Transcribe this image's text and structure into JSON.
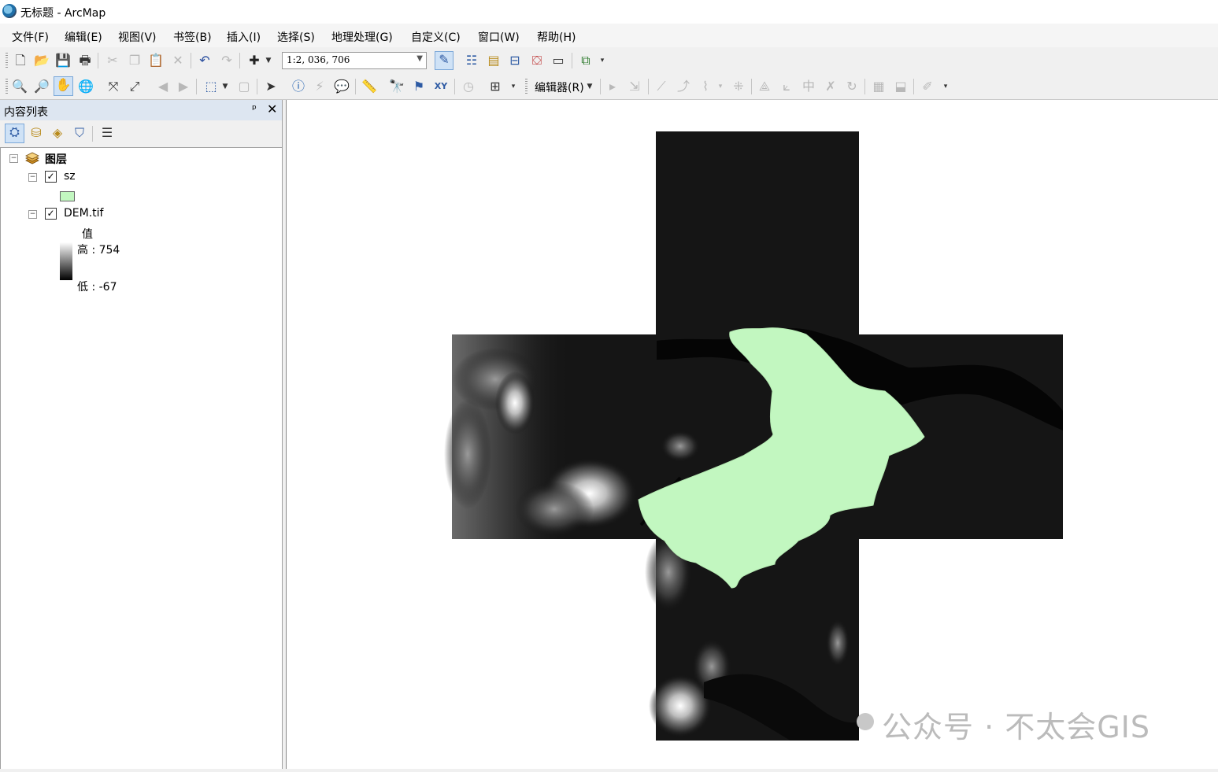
{
  "window": {
    "title": "无标题 - ArcMap"
  },
  "menubar": {
    "items": [
      "文件(F)",
      "编辑(E)",
      "视图(V)",
      "书签(B)",
      "插入(I)",
      "选择(S)",
      "地理处理(G)",
      "自定义(C)",
      "窗口(W)",
      "帮助(H)"
    ]
  },
  "toolbar": {
    "scale_value": "1:2, 036, 706",
    "editor_label": "编辑器(R)"
  },
  "toc": {
    "title": "内容列表",
    "root_label": "图层",
    "layers": [
      {
        "name": "sz",
        "checked": true,
        "symbol_color": "#c2f7c0"
      },
      {
        "name": "DEM.tif",
        "checked": true,
        "legend_field": "值",
        "high_label": "高 : 754",
        "low_label": "低 : -67"
      }
    ]
  },
  "map": {
    "raster_name": "DEM.tif",
    "polygon_layer": "sz",
    "polygon_color": "#c2f7c0",
    "background_color": "#ffffff"
  },
  "watermark": {
    "text": "公众号 · 不太会GIS"
  },
  "icons": [
    "new-document-icon",
    "open-icon",
    "save-icon",
    "print-icon",
    "cut-icon",
    "copy-icon",
    "paste-icon",
    "delete-icon",
    "undo-icon",
    "redo-icon",
    "add-data-icon",
    "editor-toolbar-icon",
    "table-of-contents-icon",
    "catalog-icon",
    "search-window-icon",
    "arctoolbox-icon",
    "python-icon",
    "model-builder-icon",
    "zoom-in-icon",
    "zoom-out-icon",
    "pan-icon",
    "full-extent-icon",
    "fixed-zoom-in-icon",
    "fixed-zoom-out-icon",
    "back-extent-icon",
    "forward-extent-icon",
    "select-features-icon",
    "clear-selection-icon",
    "select-elements-icon",
    "identify-icon",
    "hyperlink-icon",
    "html-popup-icon",
    "measure-icon",
    "find-icon",
    "find-route-icon",
    "go-to-xy-icon",
    "time-slider-icon",
    "create-viewer-icon"
  ]
}
